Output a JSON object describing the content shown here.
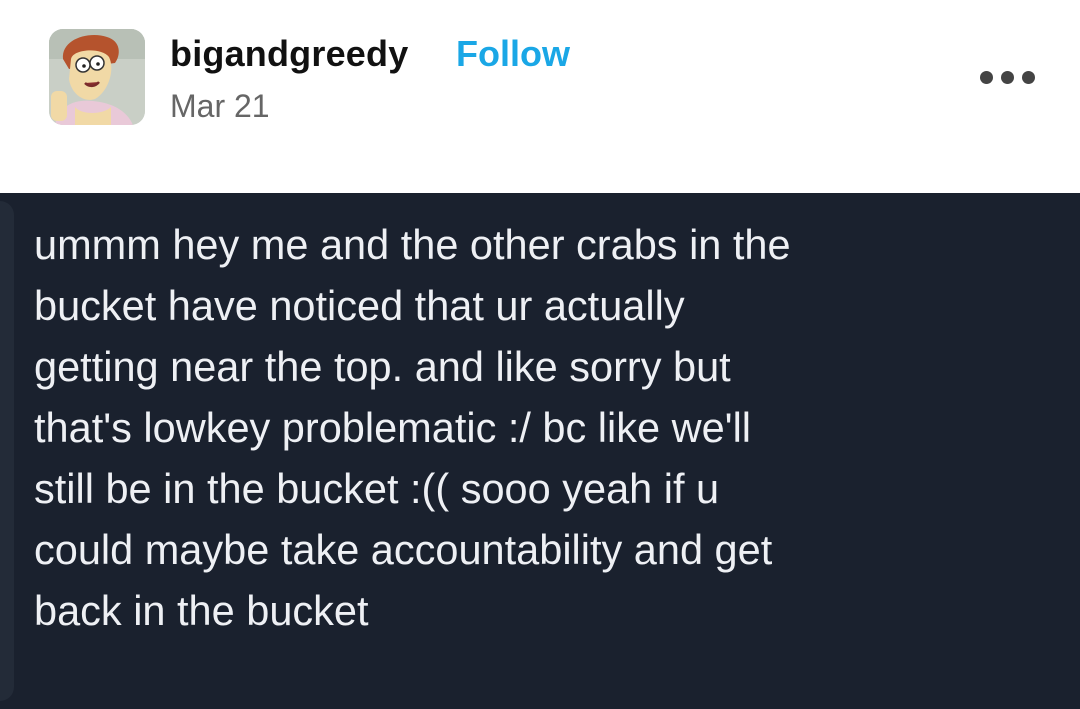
{
  "post": {
    "username": "bigandgreedy",
    "follow_label": "Follow",
    "date": "Mar 21",
    "more_icon": "more-horizontal-icon",
    "avatar_icon": "avatar-cartoon-woman",
    "image_text_lines": [
      "ummm hey me and the other crabs in the",
      "bucket have noticed that ur actually",
      "getting near the top. and like sorry but",
      "that's lowkey problematic :/ bc like we'll",
      "still be in the bucket :(( sooo yeah if u",
      "could maybe take accountability and get",
      "back in the bucket"
    ]
  },
  "colors": {
    "follow": "#1aa7e6",
    "image_background": "#1a212e",
    "image_text": "#eef0f4"
  }
}
